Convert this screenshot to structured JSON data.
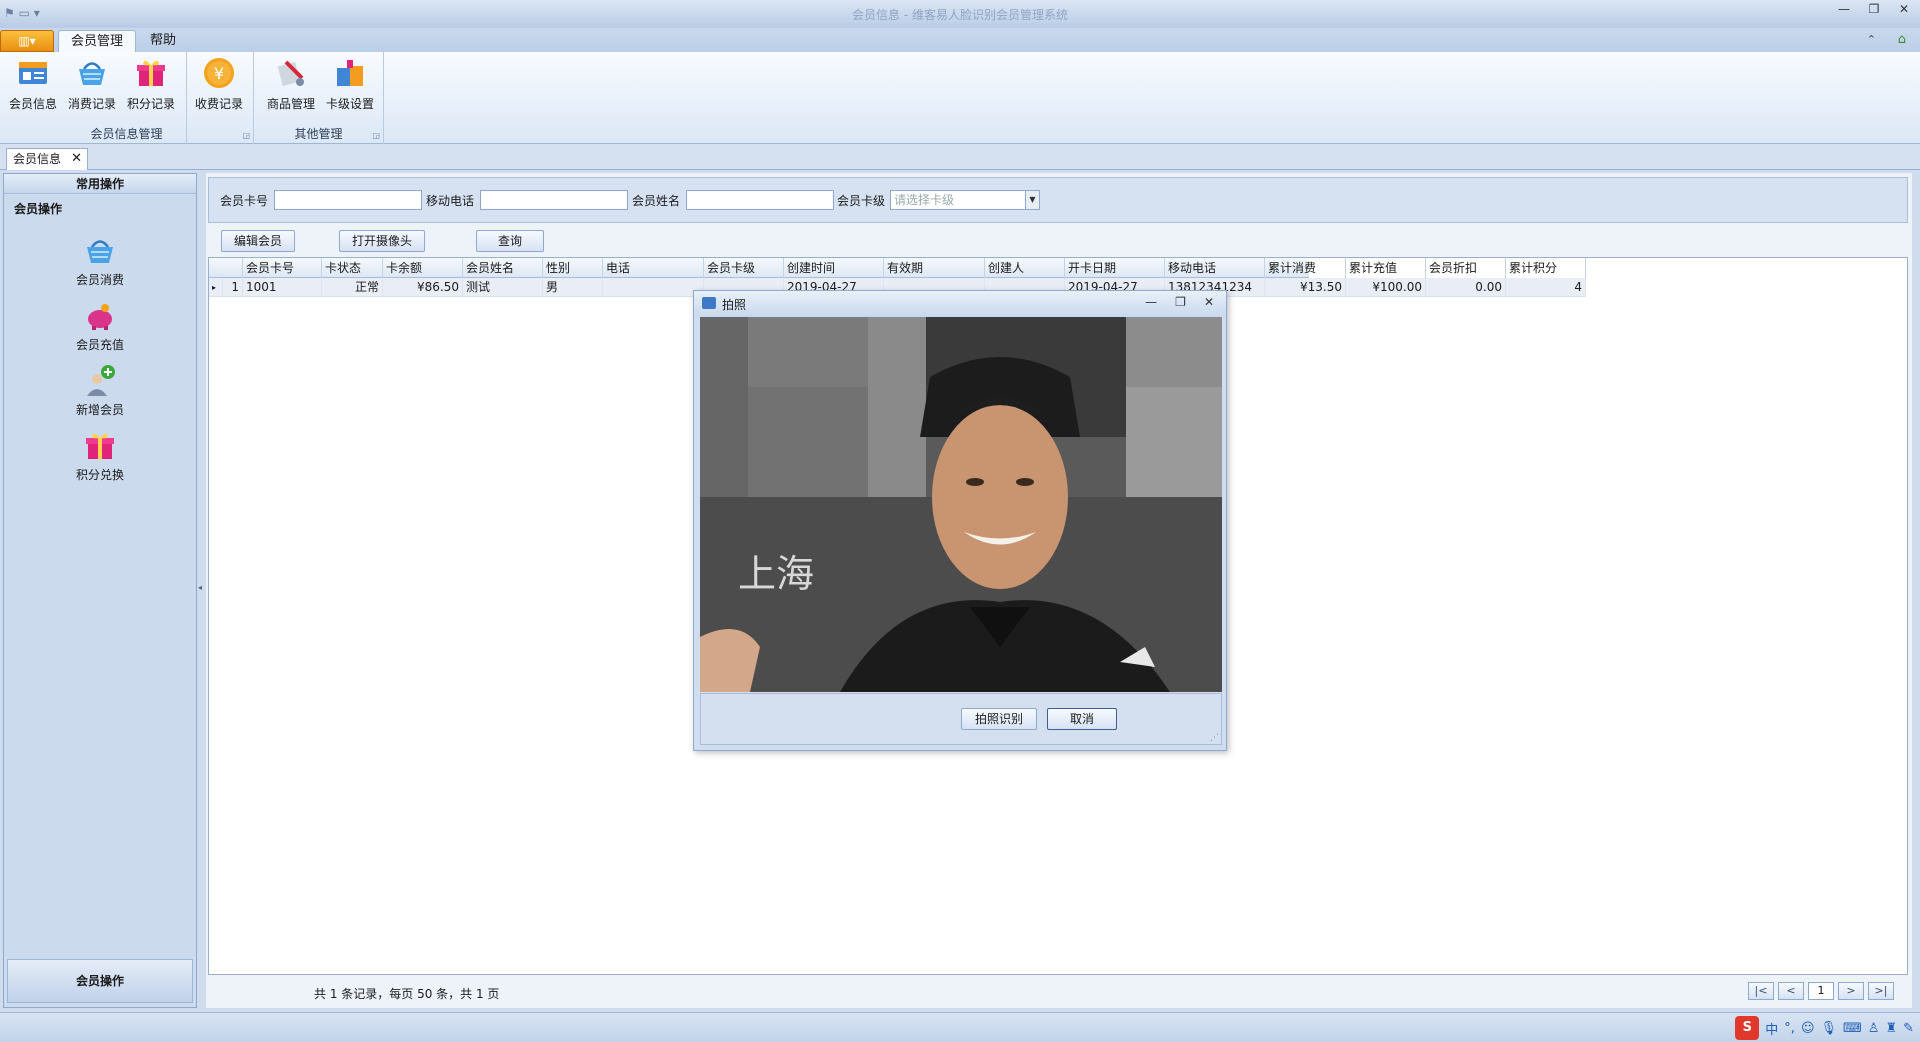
{
  "window": {
    "title": "会员信息 - 维客易人脸识别会员管理系统"
  },
  "ribbon": {
    "app_button": "▥▾",
    "tabs": [
      {
        "label": "会员管理",
        "active": true
      },
      {
        "label": "帮助",
        "active": false
      }
    ],
    "groups": [
      {
        "label": "会员信息管理",
        "buttons": [
          {
            "label": "会员信息",
            "icon": "member-info-icon"
          },
          {
            "label": "消费记录",
            "icon": "basket-icon"
          },
          {
            "label": "积分记录",
            "icon": "gift-icon"
          }
        ]
      },
      {
        "label": "",
        "buttons": [
          {
            "label": "收费记录",
            "icon": "yen-coin-icon"
          }
        ]
      },
      {
        "label": "其他管理",
        "buttons": [
          {
            "label": "商品管理",
            "icon": "product-icon"
          },
          {
            "label": "卡级设置",
            "icon": "card-level-icon"
          }
        ]
      }
    ]
  },
  "doc_tab": {
    "label": "会员信息",
    "close": "✕"
  },
  "left_panel": {
    "header": "常用操作",
    "section": "会员操作",
    "items": [
      {
        "label": "会员消费",
        "icon": "basket-icon"
      },
      {
        "label": "会员充值",
        "icon": "piggy-bank-icon"
      },
      {
        "label": "新增会员",
        "icon": "add-user-icon"
      },
      {
        "label": "积分兑换",
        "icon": "gift-icon"
      }
    ],
    "bottom_button": "会员操作"
  },
  "search": {
    "card_no_label": "会员卡号",
    "card_no_value": "",
    "mobile_label": "移动电话",
    "mobile_value": "",
    "name_label": "会员姓名",
    "name_value": "",
    "level_label": "会员卡级",
    "level_placeholder": "请选择卡级"
  },
  "toolbar": {
    "edit_label": "编辑会员",
    "camera_label": "打开摄像头",
    "query_label": "查询"
  },
  "grid": {
    "columns": [
      "会员卡号",
      "卡状态",
      "卡余额",
      "会员姓名",
      "性别",
      "电话",
      "会员卡级",
      "创建时间",
      "有效期",
      "创建人",
      "开卡日期",
      "移动电话",
      "累计消费",
      "累计充值",
      "会员折扣",
      "累计积分"
    ],
    "rows": [
      {
        "indicator": "▸",
        "index": "1",
        "card_no": "1001",
        "status": "正常",
        "balance": "¥86.50",
        "name": "测试",
        "gender": "男",
        "phone": "",
        "level": "",
        "created": "2019-04-27",
        "expiry": "",
        "creator": "",
        "open_date": "2019-04-27",
        "mobile": "13812341234",
        "total_spend": "¥13.50",
        "total_recharge": "¥100.00",
        "discount": "0.00",
        "points": "4"
      }
    ]
  },
  "footer": {
    "info": "共 1 条记录，每页 50 条，共 1 页",
    "first": "|<",
    "prev": "<",
    "page": "1",
    "next": ">",
    "last": ">|"
  },
  "dialog": {
    "title": "拍照",
    "photo_caption": "上海",
    "capture_label": "拍照识别",
    "cancel_label": "取消"
  },
  "ime": {
    "logo": "S",
    "mode": "中",
    "punct": "°,"
  }
}
